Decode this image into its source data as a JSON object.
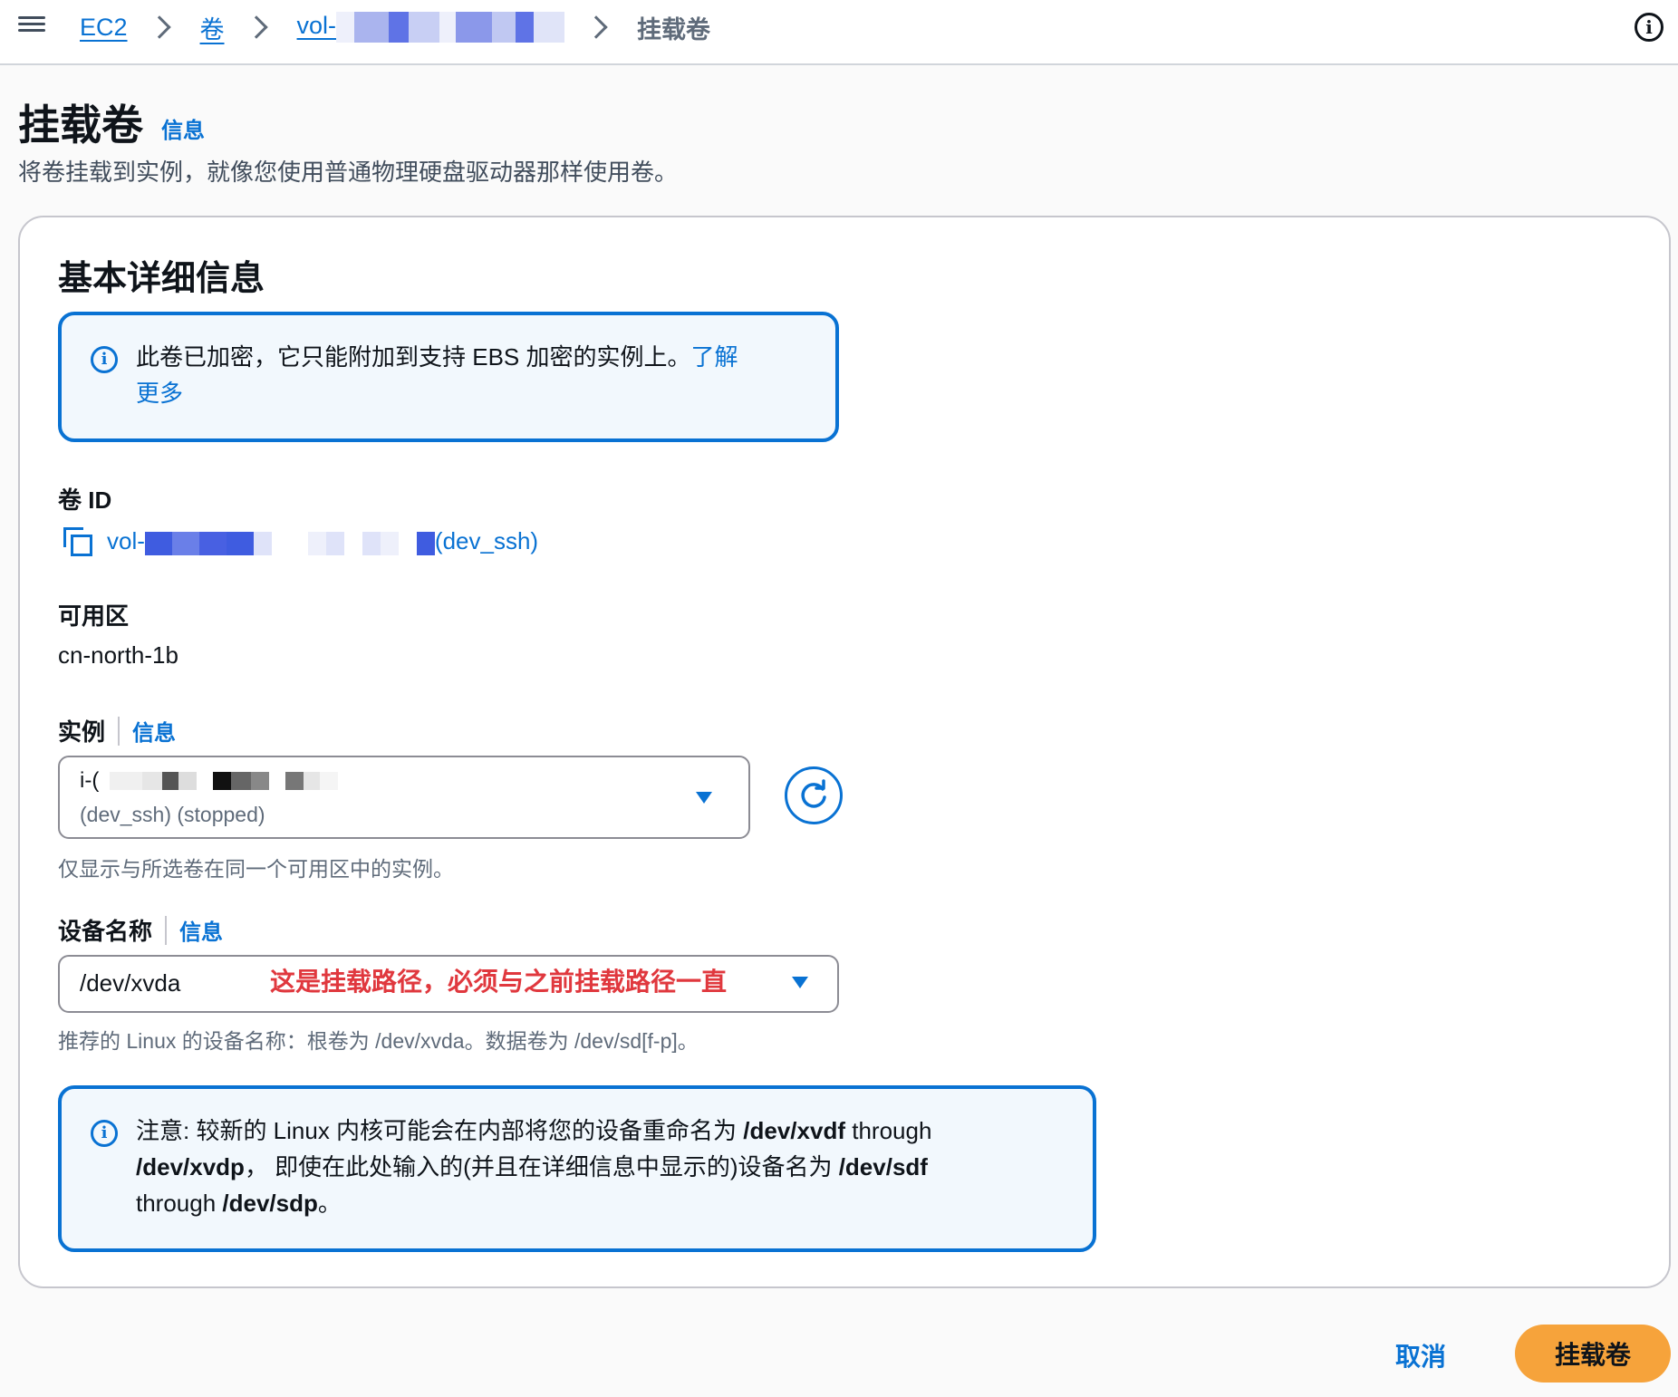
{
  "breadcrumb": {
    "items": [
      "EC2",
      "卷",
      "vol-"
    ],
    "current": "挂载卷"
  },
  "header": {
    "title": "挂载卷",
    "info": "信息",
    "description": "将卷挂载到实例，就像您使用普通物理硬盘驱动器那样使用卷。"
  },
  "section": {
    "title": "基本详细信息"
  },
  "encryption_alert": {
    "text": "此卷已加密，它只能附加到支持 EBS 加密的实例上。",
    "link_line1": "了解",
    "link_line2": "更多"
  },
  "volume": {
    "label": "卷 ID",
    "id_prefix": "vol-",
    "name_suffix": "(dev_ssh)"
  },
  "availability_zone": {
    "label": "可用区",
    "value": "cn-north-1b"
  },
  "instance": {
    "label": "实例",
    "info": "信息",
    "selected_prefix": "i-(",
    "selected_detail": "(dev_ssh) (stopped)",
    "hint": "仅显示与所选卷在同一个可用区中的实例。"
  },
  "device": {
    "label": "设备名称",
    "info": "信息",
    "value": "/dev/xvda",
    "annotation": "这是挂载路径，必须与之前挂载路径一直",
    "hint": "推荐的 Linux 的设备名称：根卷为 /dev/xvda。数据卷为 /dev/sd[f-p]。"
  },
  "note_alert": {
    "line1_a": "注意: 较新的 Linux 内核可能会在内部将您的设备重命名为 ",
    "line1_b": "/dev/xvdf",
    "line1_c": " through",
    "line2_a": "/dev/xvdp",
    "line2_b": "， 即使在此处输入的(并且在详细信息中显示的)设备名为 ",
    "line2_c": "/dev/sdf",
    "line3_a": "through ",
    "line3_b": "/dev/sdp",
    "line3_c": "。"
  },
  "footer": {
    "cancel": "取消",
    "submit": "挂载卷"
  },
  "colors": {
    "link": "#0972d3",
    "primary_button": "#f6a33b",
    "annotation": "#e0383e"
  },
  "icons": [
    "menu-icon",
    "chevron-right-icon",
    "info-circle-icon",
    "copy-icon",
    "caret-down-icon",
    "refresh-icon"
  ]
}
